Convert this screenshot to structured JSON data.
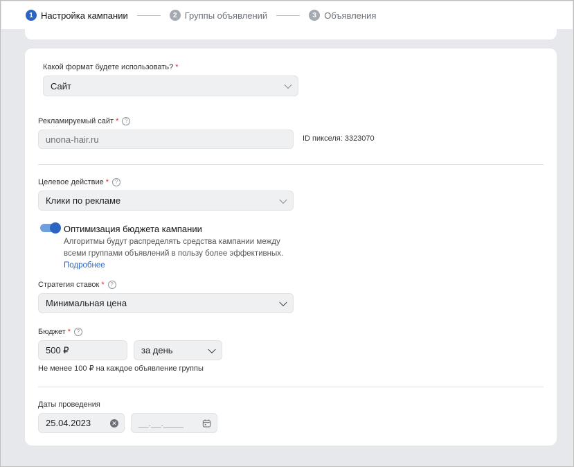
{
  "stepper": {
    "steps": [
      {
        "num": "1",
        "label": "Настройка кампании"
      },
      {
        "num": "2",
        "label": "Группы объявлений"
      },
      {
        "num": "3",
        "label": "Объявления"
      }
    ]
  },
  "format": {
    "label": "Какой формат будете использовать?",
    "required": "*",
    "value": "Сайт"
  },
  "site": {
    "label": "Рекламируемый сайт",
    "required": "*",
    "help": "?",
    "value": "unona-hair.ru",
    "pixel_id": "ID пикселя: 3323070"
  },
  "target": {
    "label": "Целевое действие",
    "required": "*",
    "help": "?",
    "value": "Клики по рекламе"
  },
  "optimization": {
    "enabled": true,
    "title": "Оптимизация бюджета кампании",
    "description": "Алгоритмы будут распределять средства кампании между всеми группами объявлений в пользу более эффективных.",
    "link": "Подробнее"
  },
  "strategy": {
    "label": "Стратегия ставок",
    "required": "*",
    "help": "?",
    "value": "Минимальная цена"
  },
  "budget": {
    "label": "Бюджет",
    "required": "*",
    "help": "?",
    "value": "500 ₽",
    "period": "за день",
    "note": "Не менее 100 ₽ на каждое объявление группы"
  },
  "dates": {
    "label": "Даты проведения",
    "start": "25.04.2023",
    "end_placeholder": "__.__.____"
  },
  "colors": {
    "accent": "#2c64c4",
    "required": "#e0292c",
    "background": "#e6e8ec"
  }
}
